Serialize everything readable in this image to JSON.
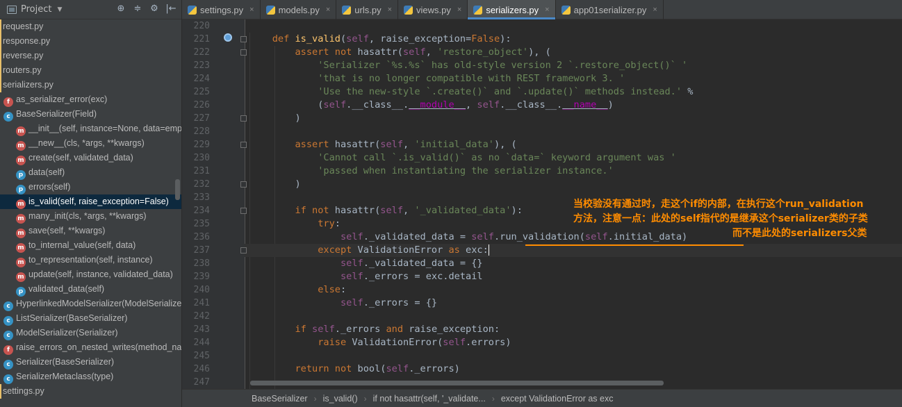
{
  "project": {
    "title": "Project",
    "tools": [
      "⊕",
      "≑",
      "⚙",
      "|←"
    ]
  },
  "tree": [
    {
      "label": "request.py",
      "type": "file"
    },
    {
      "label": "response.py",
      "type": "file"
    },
    {
      "label": "reverse.py",
      "type": "file"
    },
    {
      "label": "routers.py",
      "type": "file"
    },
    {
      "label": "serializers.py",
      "type": "file"
    },
    {
      "label": "as_serializer_error(exc)",
      "type": "f"
    },
    {
      "label": "BaseSerializer(Field)",
      "type": "c"
    },
    {
      "label": "__init__(self, instance=None, data=empty",
      "type": "m"
    },
    {
      "label": "__new__(cls, *args, **kwargs)",
      "type": "m"
    },
    {
      "label": "create(self, validated_data)",
      "type": "m"
    },
    {
      "label": "data(self)",
      "type": "p"
    },
    {
      "label": "errors(self)",
      "type": "p"
    },
    {
      "label": "is_valid(self, raise_exception=False)",
      "type": "m",
      "selected": true
    },
    {
      "label": "many_init(cls, *args, **kwargs)",
      "type": "m"
    },
    {
      "label": "save(self, **kwargs)",
      "type": "m"
    },
    {
      "label": "to_internal_value(self, data)",
      "type": "m"
    },
    {
      "label": "to_representation(self, instance)",
      "type": "m"
    },
    {
      "label": "update(self, instance, validated_data)",
      "type": "m"
    },
    {
      "label": "validated_data(self)",
      "type": "p"
    },
    {
      "label": "HyperlinkedModelSerializer(ModelSerializer)",
      "type": "c"
    },
    {
      "label": "ListSerializer(BaseSerializer)",
      "type": "c"
    },
    {
      "label": "ModelSerializer(Serializer)",
      "type": "c"
    },
    {
      "label": "raise_errors_on_nested_writes(method_name",
      "type": "f"
    },
    {
      "label": "Serializer(BaseSerializer)",
      "type": "c"
    },
    {
      "label": "SerializerMetaclass(type)",
      "type": "c"
    },
    {
      "label": "settings.py",
      "type": "file"
    }
  ],
  "tabs": [
    {
      "label": "settings.py",
      "active": false
    },
    {
      "label": "models.py",
      "active": false
    },
    {
      "label": "urls.py",
      "active": false
    },
    {
      "label": "views.py",
      "active": false
    },
    {
      "label": "serializers.py",
      "active": true
    },
    {
      "label": "app01serializer.py",
      "active": false
    }
  ],
  "editor": {
    "line_numbers": [
      "220",
      "221",
      "222",
      "223",
      "224",
      "225",
      "226",
      "227",
      "228",
      "229",
      "230",
      "231",
      "232",
      "233",
      "234",
      "235",
      "236",
      "237",
      "238",
      "239",
      "240",
      "241",
      "242",
      "243",
      "244",
      "245",
      "246",
      "247"
    ],
    "annotation": [
      "当校验没有通过时，走这个if的内部，在执行这个run_validation",
      "方法，注意一点：此处的self指代的是继承这个serializer类的子类",
      "而不是此处的serializers父类"
    ]
  },
  "breadcrumb": [
    "BaseSerializer",
    "is_valid()",
    "if not hasattr(self, '_validate...",
    "except ValidationError as exc"
  ],
  "colors": {
    "keyword": "#cc7832",
    "function": "#ffc66d",
    "string": "#6a8759",
    "self": "#94558d",
    "dunder": "#b200b2",
    "annotation": "#ff8c00",
    "selection": "#0d293e"
  }
}
